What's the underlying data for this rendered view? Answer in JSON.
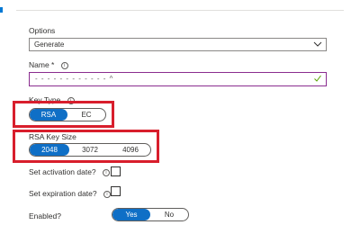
{
  "options": {
    "label": "Options",
    "value": "Generate"
  },
  "name": {
    "label": "Name *",
    "value": "- - - - - - - - - - - - ^"
  },
  "key_type": {
    "label": "Key Type",
    "options": [
      "RSA",
      "EC"
    ],
    "selected": "RSA"
  },
  "key_size": {
    "label": "RSA Key Size",
    "options": [
      "2048",
      "3072",
      "4096"
    ],
    "selected": "2048"
  },
  "activation": {
    "label": "Set activation date?"
  },
  "expiration": {
    "label": "Set expiration date?"
  },
  "enabled": {
    "label": "Enabled?",
    "options": [
      "Yes",
      "No"
    ],
    "selected": "Yes"
  },
  "colors": {
    "accent": "#0f6fc6",
    "highlight": "#d81e2c",
    "valid": "#57a300"
  },
  "icons": {
    "chevron": "chevron-down-icon",
    "check": "checkmark-icon",
    "info": "info-icon"
  }
}
